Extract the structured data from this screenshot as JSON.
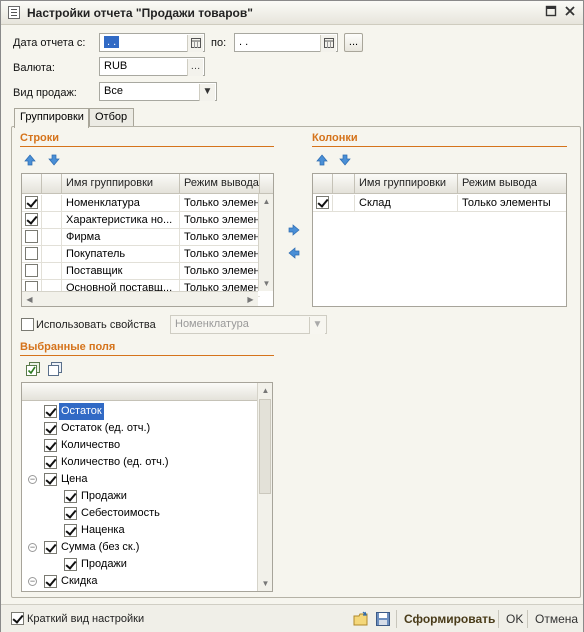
{
  "window": {
    "title": "Настройки отчета \"Продажи товаров\""
  },
  "form": {
    "date_from_label": "Дата отчета с:",
    "date_from_value": ". .",
    "date_to_label": "по:",
    "date_to_value": ". .",
    "period_button": "...",
    "currency_label": "Валюта:",
    "currency_value": "RUB",
    "sales_type_label": "Вид продаж:",
    "sales_type_value": "Все"
  },
  "tabs": [
    {
      "label": "Группировки"
    },
    {
      "label": "Отбор"
    }
  ],
  "rows_section": {
    "title": "Строки",
    "columns": [
      "Имя группировки",
      "Режим вывода"
    ],
    "items": [
      {
        "checked": true,
        "name": "Номенклатура",
        "mode": "Только элемен"
      },
      {
        "checked": true,
        "name": "Характеристика но...",
        "mode": "Только элемен"
      },
      {
        "checked": false,
        "name": "Фирма",
        "mode": "Только элемен"
      },
      {
        "checked": false,
        "name": "Покупатель",
        "mode": "Только элемен"
      },
      {
        "checked": false,
        "name": "Поставщик",
        "mode": "Только элемен"
      },
      {
        "checked": false,
        "name": "Основной поставщ...",
        "mode": "Только элемен"
      }
    ]
  },
  "columns_section": {
    "title": "Колонки",
    "columns": [
      "Имя группировки",
      "Режим вывода"
    ],
    "items": [
      {
        "checked": true,
        "name": "Склад",
        "mode": "Только элементы"
      }
    ]
  },
  "use_properties": {
    "label": "Использовать свойства",
    "value": "Номенклатура"
  },
  "selected_fields": {
    "title": "Выбранные поля",
    "items": [
      {
        "label": "Остаток",
        "level": 0,
        "checked": true,
        "group": false,
        "selected": true
      },
      {
        "label": "Остаток (ед. отч.)",
        "level": 0,
        "checked": true,
        "group": false,
        "selected": false
      },
      {
        "label": "Количество",
        "level": 0,
        "checked": true,
        "group": false,
        "selected": false
      },
      {
        "label": "Количество (ед. отч.)",
        "level": 0,
        "checked": true,
        "group": false,
        "selected": false
      },
      {
        "label": "Цена",
        "level": 0,
        "checked": true,
        "group": true,
        "selected": false
      },
      {
        "label": "Продажи",
        "level": 1,
        "checked": true,
        "group": false,
        "selected": false
      },
      {
        "label": "Себестоимость",
        "level": 1,
        "checked": true,
        "group": false,
        "selected": false
      },
      {
        "label": "Наценка",
        "level": 1,
        "checked": true,
        "group": false,
        "selected": false
      },
      {
        "label": "Сумма (без ск.)",
        "level": 0,
        "checked": true,
        "group": true,
        "selected": false
      },
      {
        "label": "Продажи",
        "level": 1,
        "checked": true,
        "group": false,
        "selected": false
      },
      {
        "label": "Скидка",
        "level": 0,
        "checked": true,
        "group": true,
        "selected": false
      }
    ]
  },
  "footer": {
    "short_view_label": "Краткий вид настройки",
    "generate_label": "Сформировать",
    "ok_label": "OK",
    "cancel_label": "Отмена"
  },
  "colors": {
    "accent": "#d5731b",
    "selection": "#316ac5",
    "arrow": "#4a8fd6"
  }
}
